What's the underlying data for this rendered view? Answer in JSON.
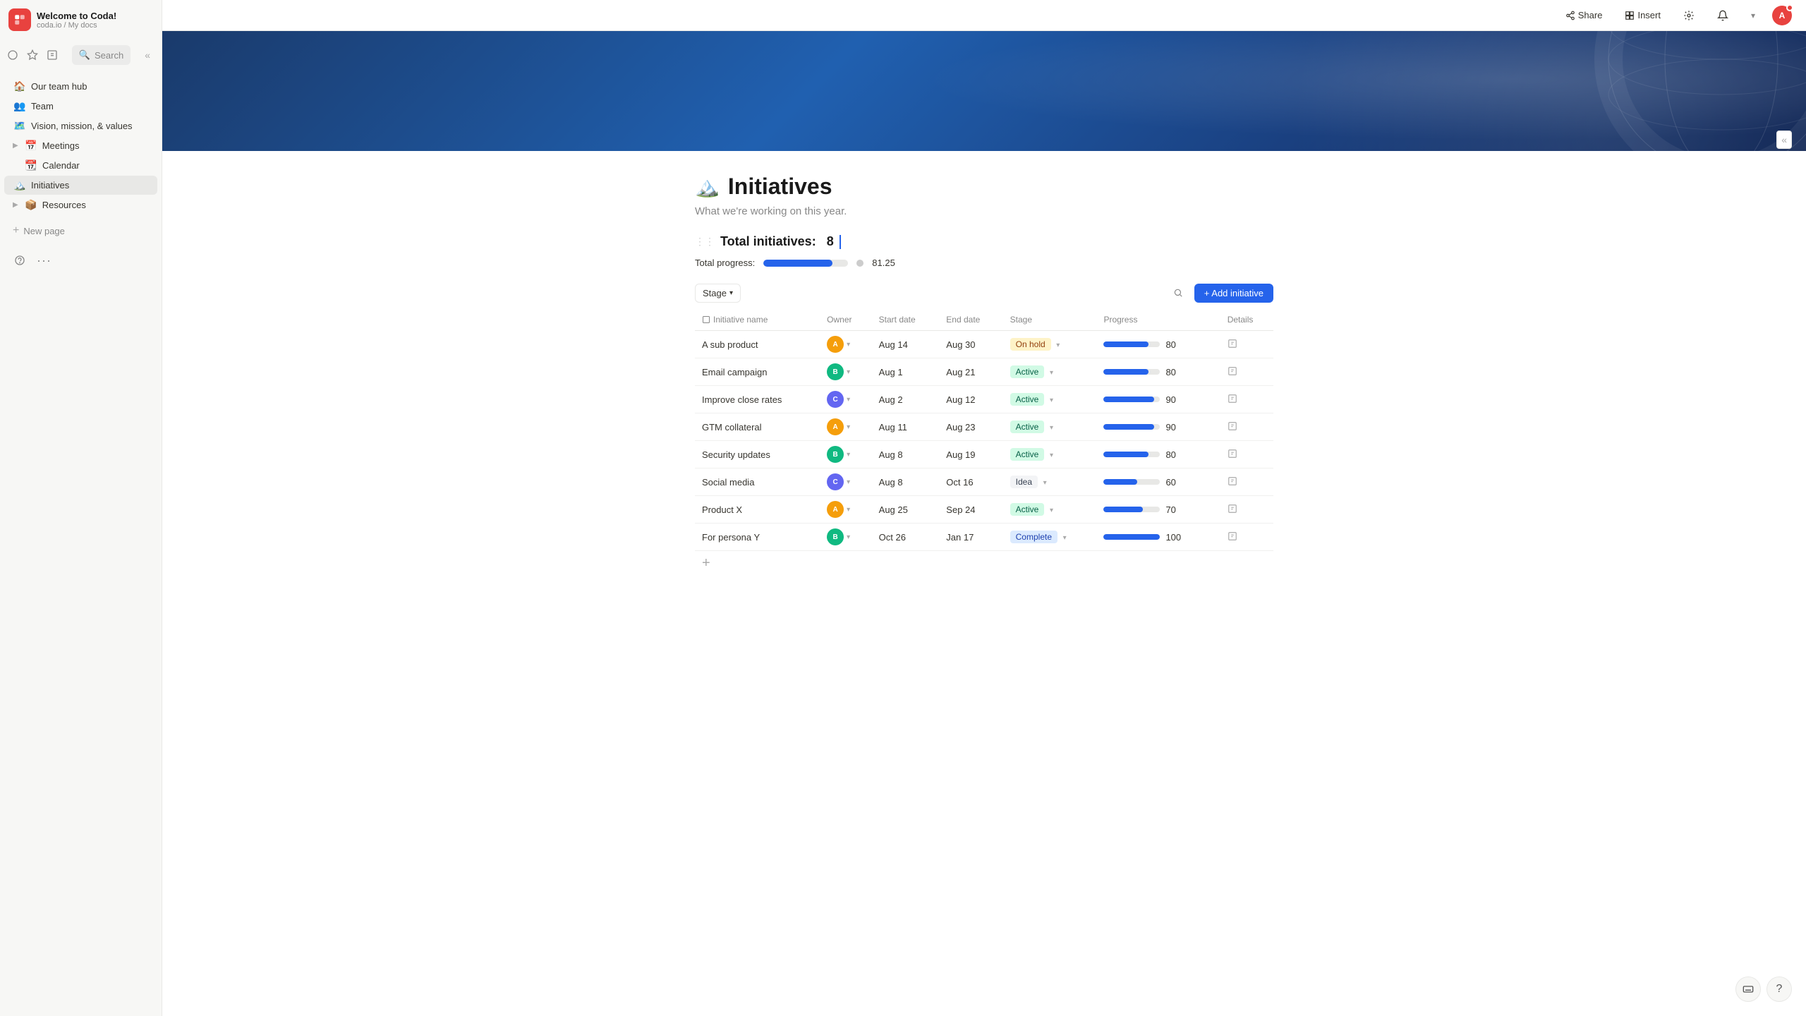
{
  "app": {
    "logo": "C",
    "workspace": "Welcome to Coda!",
    "breadcrumb": "coda.io / My docs"
  },
  "topbar": {
    "share": "Share",
    "insert": "Insert",
    "avatar_initials": "A"
  },
  "sidebar": {
    "search_placeholder": "Search",
    "items": [
      {
        "id": "team-hub",
        "label": "Our team hub",
        "icon": "🏠",
        "indent": false
      },
      {
        "id": "team",
        "label": "Team",
        "icon": "👥",
        "indent": false
      },
      {
        "id": "vision",
        "label": "Vision, mission, & values",
        "icon": "🗺️",
        "indent": false
      },
      {
        "id": "meetings",
        "label": "Meetings",
        "icon": "📅",
        "indent": false,
        "hasChevron": true
      },
      {
        "id": "calendar",
        "label": "Calendar",
        "icon": "📆",
        "indent": true
      },
      {
        "id": "initiatives",
        "label": "Initiatives",
        "icon": "🏔️",
        "indent": false,
        "active": true
      },
      {
        "id": "resources",
        "label": "Resources",
        "icon": "📦",
        "indent": false,
        "hasChevron": true
      }
    ],
    "new_page": "New page"
  },
  "page": {
    "icon": "🏔️",
    "title": "Initiatives",
    "subtitle": "What we're working on this year.",
    "total_initiatives_label": "Total initiatives:",
    "total_initiatives_count": "8",
    "total_progress_label": "Total progress:",
    "total_progress_value": 81.25,
    "total_progress_display": "81.25",
    "stage_filter_label": "Stage",
    "add_initiative_label": "+ Add initiative"
  },
  "table": {
    "columns": [
      {
        "id": "name",
        "label": "Initiative name"
      },
      {
        "id": "owner",
        "label": "Owner"
      },
      {
        "id": "start",
        "label": "Start date"
      },
      {
        "id": "end",
        "label": "End date"
      },
      {
        "id": "stage",
        "label": "Stage"
      },
      {
        "id": "progress",
        "label": "Progress"
      },
      {
        "id": "details",
        "label": "Details"
      }
    ],
    "rows": [
      {
        "name": "A sub product",
        "owner_color": "#f59e0b",
        "owner_initials": "A",
        "start": "Aug 14",
        "end": "Aug 30",
        "stage": "On hold",
        "stage_class": "onhold",
        "progress": 80
      },
      {
        "name": "Email campaign",
        "owner_color": "#10b981",
        "owner_initials": "B",
        "start": "Aug 1",
        "end": "Aug 21",
        "stage": "Active",
        "stage_class": "active",
        "progress": 80
      },
      {
        "name": "Improve close rates",
        "owner_color": "#6366f1",
        "owner_initials": "C",
        "start": "Aug 2",
        "end": "Aug 12",
        "stage": "Active",
        "stage_class": "active",
        "progress": 90
      },
      {
        "name": "GTM collateral",
        "owner_color": "#f59e0b",
        "owner_initials": "A",
        "start": "Aug 11",
        "end": "Aug 23",
        "stage": "Active",
        "stage_class": "active",
        "progress": 90
      },
      {
        "name": "Security updates",
        "owner_color": "#10b981",
        "owner_initials": "B",
        "start": "Aug 8",
        "end": "Aug 19",
        "stage": "Active",
        "stage_class": "active",
        "progress": 80
      },
      {
        "name": "Social media",
        "owner_color": "#6366f1",
        "owner_initials": "C",
        "start": "Aug 8",
        "end": "Oct 16",
        "stage": "Idea",
        "stage_class": "idea",
        "progress": 60
      },
      {
        "name": "Product X",
        "owner_color": "#f59e0b",
        "owner_initials": "A",
        "start": "Aug 25",
        "end": "Sep 24",
        "stage": "Active",
        "stage_class": "active",
        "progress": 70
      },
      {
        "name": "For persona Y",
        "owner_color": "#10b981",
        "owner_initials": "B",
        "start": "Oct 26",
        "end": "Jan 17",
        "stage": "Complete",
        "stage_class": "complete",
        "progress": 100
      }
    ]
  }
}
